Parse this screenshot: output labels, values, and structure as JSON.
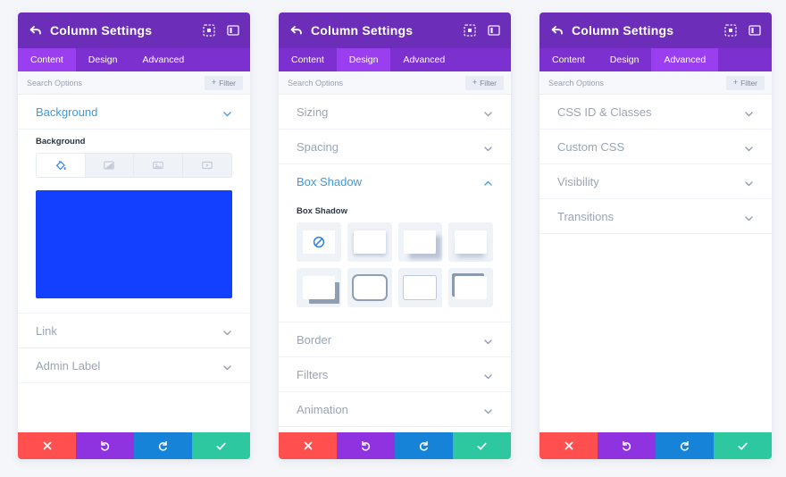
{
  "header": {
    "title": "Column Settings",
    "back_icon": "back-arrow-icon",
    "icons": [
      {
        "name": "focus-expand-icon"
      },
      {
        "name": "panel-layout-icon"
      }
    ]
  },
  "search": {
    "placeholder": "Search Options",
    "value": "",
    "filter_label": "Filter",
    "filter_plus": "+"
  },
  "tabs": [
    {
      "label": "Content"
    },
    {
      "label": "Design"
    },
    {
      "label": "Advanced"
    }
  ],
  "footer": {
    "cancel_icon": "close-icon",
    "undo_icon": "undo-icon",
    "redo_icon": "redo-icon",
    "save_icon": "check-icon"
  },
  "colors": {
    "header_purple": "#6c2eb9",
    "tabs_purple": "#7b30cf",
    "tab_active_purple": "#9a3ff0",
    "accent_blue": "#3b9ae1",
    "swatch_blue": "#1340ff",
    "cancel_red": "#ff4f4f",
    "undo_purple": "#8f32e0",
    "redo_blue": "#1683d8",
    "save_green": "#2dc8a0"
  },
  "panels": [
    {
      "id": "content-panel",
      "active_tab": "Content",
      "sections": [
        {
          "label": "Background",
          "open": true
        },
        {
          "label": "Link",
          "open": false
        },
        {
          "label": "Admin Label",
          "open": false
        }
      ],
      "background": {
        "field_label": "Background",
        "type_tabs": [
          {
            "name": "background-color-icon",
            "active": true
          },
          {
            "name": "background-gradient-icon",
            "active": false
          },
          {
            "name": "background-image-icon",
            "active": false
          },
          {
            "name": "background-video-icon",
            "active": false
          }
        ],
        "selected_color": "#1340ff"
      }
    },
    {
      "id": "design-panel",
      "active_tab": "Design",
      "sections": [
        {
          "label": "Sizing",
          "open": false
        },
        {
          "label": "Spacing",
          "open": false
        },
        {
          "label": "Box Shadow",
          "open": true
        },
        {
          "label": "Border",
          "open": false
        },
        {
          "label": "Filters",
          "open": false
        },
        {
          "label": "Animation",
          "open": false
        }
      ],
      "box_shadow": {
        "field_label": "Box Shadow",
        "presets": [
          {
            "name": "box-shadow-none-preset"
          },
          {
            "name": "box-shadow-soft-bottom-preset"
          },
          {
            "name": "box-shadow-offset-bottom-right-preset"
          },
          {
            "name": "box-shadow-blurred-bottom-preset"
          },
          {
            "name": "box-shadow-hard-bottom-right-preset"
          },
          {
            "name": "box-shadow-outline-all-preset"
          },
          {
            "name": "box-shadow-light-outline-preset"
          },
          {
            "name": "box-shadow-hard-top-left-preset"
          }
        ]
      }
    },
    {
      "id": "advanced-panel",
      "active_tab": "Advanced",
      "sections": [
        {
          "label": "CSS ID & Classes",
          "open": false
        },
        {
          "label": "Custom CSS",
          "open": false
        },
        {
          "label": "Visibility",
          "open": false
        },
        {
          "label": "Transitions",
          "open": false
        }
      ]
    }
  ]
}
